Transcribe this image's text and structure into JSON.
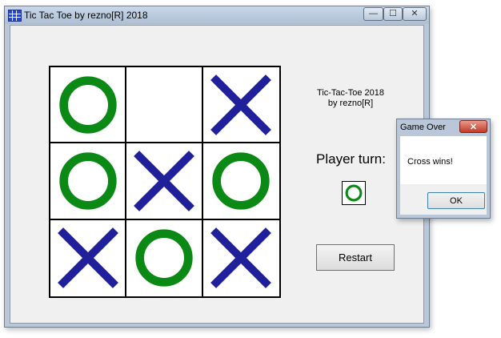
{
  "window": {
    "title": "Tic Tac Toe by rezno[R] 2018",
    "controls": {
      "minimize": "—",
      "maximize": "☐",
      "close": "✕"
    }
  },
  "board": {
    "cells": [
      "O",
      "",
      "X",
      "O",
      "X",
      "O",
      "X",
      "O",
      "X"
    ],
    "colors": {
      "O": "#0a8a14",
      "X": "#20209a"
    }
  },
  "info": {
    "line1": "Tic-Tac-Toe 2018",
    "line2": "by rezno[R]",
    "player_turn_label": "Player turn:",
    "current_player": "O"
  },
  "restart_label": "Restart",
  "dialog": {
    "title": "Game Over",
    "close_glyph": "✕",
    "message": "Cross wins!",
    "ok_label": "OK"
  }
}
